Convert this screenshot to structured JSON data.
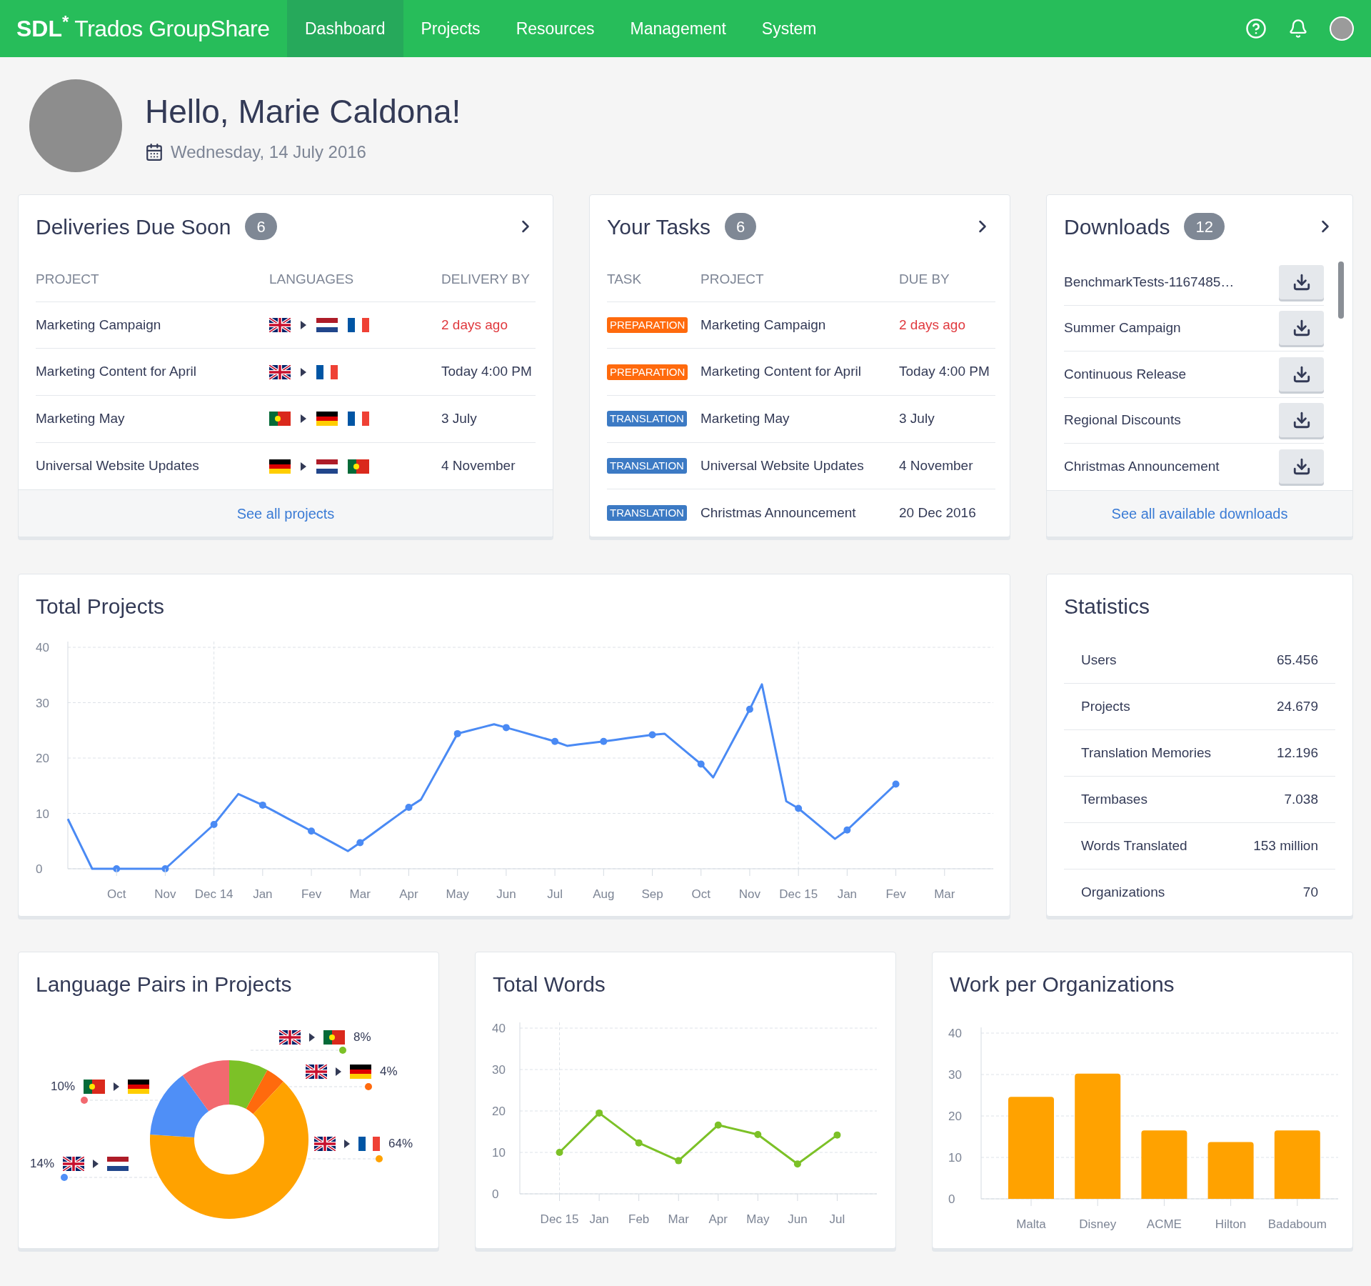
{
  "topbar": {
    "logo": {
      "brand": "SDL$^{*}$",
      "product": "Trados GroupShare"
    },
    "nav": [
      {
        "label": "Dashboard",
        "selected": true
      },
      {
        "label": "Projects",
        "selected": false
      },
      {
        "label": "Resources",
        "selected": false
      },
      {
        "label": "Management",
        "selected": false
      },
      {
        "label": "System",
        "selected": false
      }
    ]
  },
  "greeting": {
    "title": "Hello, Marie Caldona!",
    "date": "Wednesday, 14 July 2016"
  },
  "deliveries": {
    "title": "Deliveries Due Soon",
    "count": "6",
    "columns": [
      "PROJECT",
      "LANGUAGES",
      "DELIVERY BY"
    ],
    "rows": [
      {
        "project": "Marketing Campaign",
        "source_flag": {
          "kind": "gb"
        },
        "target_flags": [
          {
            "kind": "nl"
          },
          {
            "kind": "fr"
          }
        ],
        "delivery": "2 days ago",
        "overdue": true
      },
      {
        "project": "Marketing Content for April",
        "source_flag": {
          "kind": "gb"
        },
        "target_flags": [
          {
            "kind": "fr"
          }
        ],
        "delivery": "Today 4:00 PM",
        "overdue": false
      },
      {
        "project": "Marketing May",
        "source_flag": {
          "kind": "pt"
        },
        "target_flags": [
          {
            "kind": "de"
          },
          {
            "kind": "fr"
          }
        ],
        "delivery": "3 July",
        "overdue": false
      },
      {
        "project": "Universal Website Updates",
        "source_flag": {
          "kind": "de"
        },
        "target_flags": [
          {
            "kind": "nl"
          },
          {
            "kind": "pt"
          }
        ],
        "delivery": "4 November",
        "overdue": false
      }
    ],
    "footer_link": "See all projects"
  },
  "tasks": {
    "title": "Your Tasks",
    "count": "6",
    "columns": [
      "TASK",
      "PROJECT",
      "DUE BY"
    ],
    "rows": [
      {
        "task": "PREPARATION",
        "kind": "preparation",
        "project": "Marketing Campaign",
        "due": "2 days ago",
        "overdue": true
      },
      {
        "task": "PREPARATION",
        "kind": "preparation",
        "project": "Marketing Content for April",
        "due": "Today 4:00 PM",
        "overdue": false
      },
      {
        "task": "TRANSLATION",
        "kind": "translation",
        "project": "Marketing May",
        "due": "3 July",
        "overdue": false
      },
      {
        "task": "TRANSLATION",
        "kind": "translation",
        "project": "Universal Website Updates",
        "due": "4 November",
        "overdue": false
      },
      {
        "task": "TRANSLATION",
        "kind": "translation",
        "project": "Christmas Announcement",
        "due": "20 Dec 2016",
        "overdue": false
      }
    ]
  },
  "downloads": {
    "title": "Downloads",
    "count": "12",
    "items": [
      "BenchmarkTests-1167485…",
      "Summer Campaign",
      "Continuous Release",
      "Regional Discounts",
      "Christmas Announcement"
    ],
    "footer_link": "See all available downloads"
  },
  "total_projects": {
    "title": "Total Projects",
    "chart_data": {
      "type": "line",
      "categories": [
        null,
        null,
        null,
        null,
        "Oct",
        null,
        null,
        null,
        "Nov",
        null,
        null,
        null,
        "Dec 14",
        null,
        null,
        null,
        "Jan",
        null,
        null,
        null,
        "Fev",
        null,
        null,
        null,
        "Mar",
        null,
        null,
        null,
        "Apr",
        null,
        null,
        null,
        "May",
        null,
        null,
        null,
        "Jun",
        null,
        null,
        null,
        "Jul",
        null,
        null,
        null,
        "Aug",
        null,
        null,
        null,
        "Sep",
        null,
        null,
        null,
        "Oct",
        null,
        null,
        null,
        "Nov",
        null,
        null,
        null,
        "Dec 15",
        null,
        null,
        null,
        "Jan",
        null,
        null,
        null,
        "Fev",
        null,
        null,
        null,
        "Mar"
      ],
      "series": [
        {
          "color": "#4a8af4",
          "marker": true,
          "values": [
            9,
            4.5,
            0,
            0,
            0,
            0,
            0,
            0,
            0,
            2,
            4,
            6,
            8,
            10.75,
            13.5,
            12.5,
            11.5,
            10.33,
            9.15,
            7.98,
            6.8,
            5.6,
            4.4,
            3.2,
            4.7,
            6.3,
            7.9,
            9.5,
            11.1,
            12.5,
            16.47,
            20.43,
            24.4,
            24.97,
            25.53,
            26.1,
            25.5,
            24.88,
            24.25,
            23.63,
            23,
            22.2,
            22.47,
            22.73,
            23,
            23.3,
            23.6,
            23.9,
            24.2,
            24.4,
            22.57,
            20.73,
            18.9,
            16.5,
            20.6,
            24.7,
            28.8,
            33.3,
            22.75,
            12.2,
            10.9,
            9.07,
            7.23,
            5.4,
            7,
            9.08,
            11.15,
            13.23,
            15.3,
            null,
            null,
            null,
            null
          ]
        }
      ],
      "ylim": [
        0,
        40
      ],
      "yticks": [
        0,
        10,
        20,
        30,
        40
      ],
      "grid": true
    }
  },
  "statistics": {
    "title": "Statistics",
    "rows": [
      {
        "label": "Users",
        "value": "65.456"
      },
      {
        "label": "Projects",
        "value": "24.679"
      },
      {
        "label": "Translation Memories",
        "value": "12.196"
      },
      {
        "label": "Termbases",
        "value": "7.038"
      },
      {
        "label": "Words Translated",
        "value": "153 million"
      },
      {
        "label": "Organizations",
        "value": "70"
      }
    ]
  },
  "language_pairs": {
    "title": "Language Pairs in Projects",
    "labels": [
      {
        "percent": "8%",
        "source_flag": {
          "kind": "gb"
        },
        "target_flag": {
          "kind": "pt"
        },
        "color": "#7cc127"
      },
      {
        "percent": "4%",
        "source_flag": {
          "kind": "gb"
        },
        "target_flag": {
          "kind": "de"
        },
        "color": "#ff6a0d"
      },
      {
        "percent": "64%",
        "source_flag": {
          "kind": "gb"
        },
        "target_flag": {
          "kind": "fr"
        },
        "color": "#ffa200"
      },
      {
        "percent": "14%",
        "source_flag": {
          "kind": "gb"
        },
        "target_flag": {
          "kind": "nl"
        },
        "color": "#4f8ff7"
      },
      {
        "percent": "10%",
        "source_flag": {
          "kind": "pt"
        },
        "target_flag": {
          "kind": "de"
        },
        "color": "#f2696f"
      }
    ],
    "chart_data": {
      "type": "donut",
      "values": [
        8,
        4,
        64,
        14,
        10
      ]
    }
  },
  "total_words": {
    "title": "Total Words",
    "chart_data": {
      "type": "line",
      "categories": [
        "Dec 15",
        "Jan",
        "Feb",
        "Mar",
        "Apr",
        "May",
        "Jun",
        "Jul"
      ],
      "series": [
        {
          "color": "#7cc127",
          "marker": true,
          "values": [
            10,
            19.5,
            12.3,
            8,
            16.6,
            14.3,
            7.2,
            14.2
          ]
        }
      ],
      "ylim": [
        0,
        40
      ],
      "yticks": [
        0,
        10,
        20,
        30,
        40
      ],
      "grid": true
    }
  },
  "work_per_org": {
    "title": "Work per Organizations",
    "chart_data": {
      "type": "bar",
      "categories": [
        "Malta",
        "Disney",
        "ACME",
        "Hilton",
        "Badaboum"
      ],
      "series": [
        {
          "color": "#ffa200",
          "values": [
            24.6,
            30.2,
            16.5,
            13.7,
            16.5
          ]
        }
      ],
      "ylim": [
        0,
        40
      ],
      "yticks": [
        0,
        10,
        20,
        30,
        40
      ],
      "grid": true
    }
  }
}
